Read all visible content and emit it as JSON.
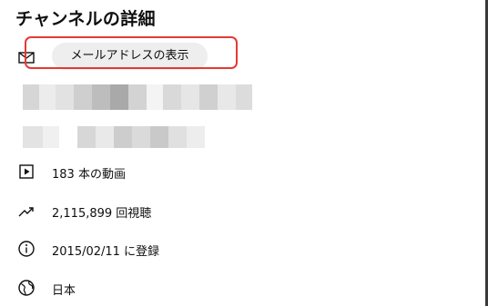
{
  "panel": {
    "title": "チャンネルの詳細",
    "email": {
      "icon": "mail-icon",
      "button_label": "メールアドレスの表示",
      "highlight_color": "#e53935"
    },
    "stats": [
      {
        "icon": "play-box-icon",
        "text": "183 本の動画"
      },
      {
        "icon": "trending-up-icon",
        "text": "2,115,899 回視聴"
      },
      {
        "icon": "info-icon",
        "text": "2015/02/11 に登録"
      },
      {
        "icon": "globe-icon",
        "text": "日本"
      }
    ]
  }
}
